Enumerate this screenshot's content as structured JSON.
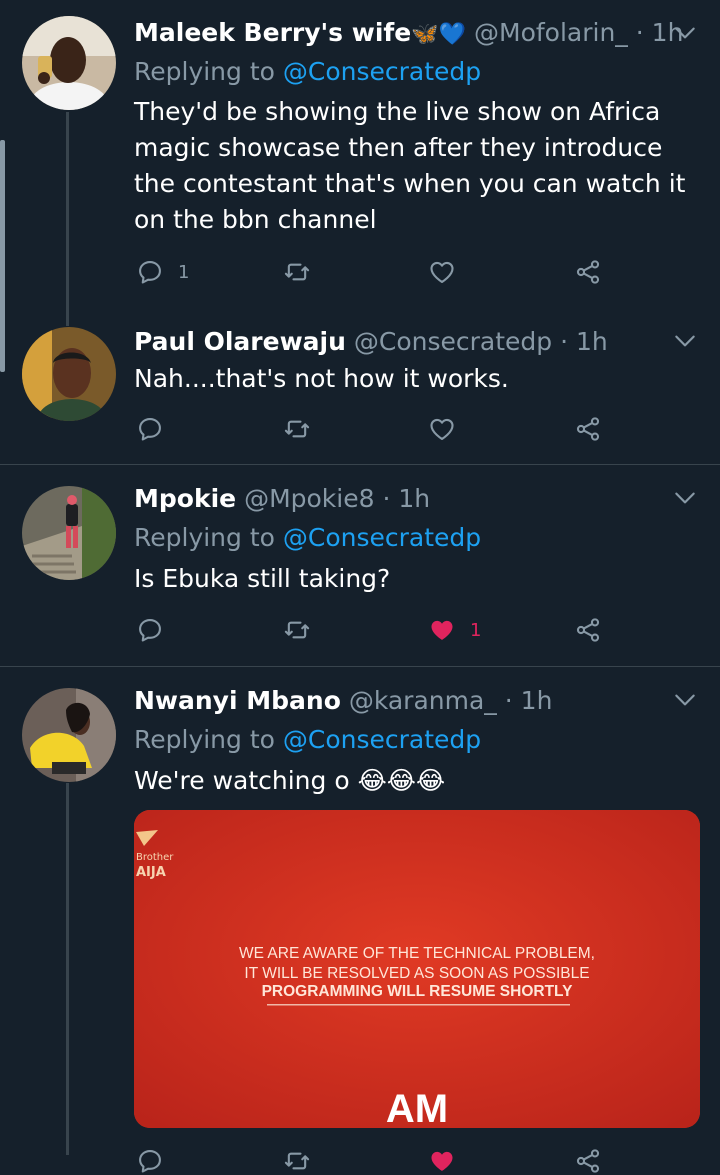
{
  "tweets": [
    {
      "name": "Maleek Berry's wife",
      "name_emoji": "🦋💙",
      "handle": "@Mofolarin_",
      "dot": "·",
      "time": "1h",
      "replying_prefix": "Replying to",
      "replying_to": "@Consecratedp",
      "text": "They'd be showing the live show on Africa magic showcase then after they introduce the contestant that's when you can watch it on the bbn channel",
      "reply_count": "1",
      "like_count": ""
    },
    {
      "name": "Paul Olarewaju",
      "handle": "@Consecratedp",
      "dot": "·",
      "time": "1h",
      "text": "Nah....that's not how it works.",
      "reply_count": "",
      "like_count": ""
    },
    {
      "name": "Mpokie",
      "handle": "@Mpokie8",
      "dot": "·",
      "time": "1h",
      "replying_prefix": "Replying to",
      "replying_to": "@Consecratedp",
      "text": "Is Ebuka still taking?",
      "reply_count": "",
      "like_count": "1"
    },
    {
      "name": "Nwanyi Mbano",
      "handle": "@karanma_",
      "dot": "·",
      "time": "1h",
      "replying_prefix": "Replying to",
      "replying_to": "@Consecratedp",
      "text": "We're watching o",
      "text_emoji": "😂😂😂",
      "reply_count": "",
      "like_count": ""
    }
  ],
  "media": {
    "logo_top": "Brother",
    "logo_bottom": "AIJA",
    "line1": "WE ARE AWARE OF THE TECHNICAL PROBLEM,",
    "line2": "IT WILL BE RESOLVED AS SOON AS POSSIBLE",
    "line3": "PROGRAMMING WILL RESUME SHORTLY",
    "channel_logo": "AM"
  },
  "colors": {
    "background": "#15202b",
    "secondary_text": "#8899a6",
    "link": "#1da1f2",
    "like": "#e0245e",
    "divider": "#38444d"
  },
  "icons": {
    "reply": "reply-icon",
    "retweet": "retweet-icon",
    "like": "heart-icon",
    "share": "share-icon",
    "menu": "chevron-down-icon"
  }
}
